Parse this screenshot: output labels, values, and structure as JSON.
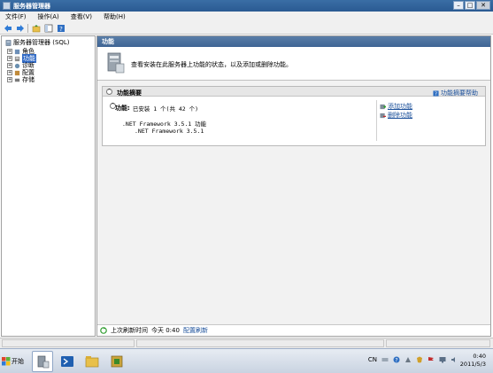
{
  "window": {
    "title": "服务器管理器"
  },
  "menu": [
    "文件(F)",
    "操作(A)",
    "查看(V)",
    "帮助(H)"
  ],
  "tree": {
    "root": "服务器管理器 (SQL)",
    "items": [
      {
        "label": "角色",
        "selected": false
      },
      {
        "label": "功能",
        "selected": true
      },
      {
        "label": "诊断",
        "selected": false
      },
      {
        "label": "配置",
        "selected": false
      },
      {
        "label": "存储",
        "selected": false
      }
    ]
  },
  "content": {
    "header": "功能",
    "description": "查看安装在此服务器上功能的状态，以及添加或删除功能。",
    "summary": {
      "title": "功能摘要",
      "help_link": "功能摘要帮助",
      "features_label": "功能:",
      "features_value": "已安装 1 个(共 42 个)",
      "installed": [
        ".NET Framework 3.5.1 功能",
        ".NET Framework 3.5.1"
      ],
      "actions": [
        "添加功能",
        "删除功能"
      ]
    },
    "refresh": {
      "label": "上次刷新时间",
      "time": "今天 0:40",
      "link": "配置刷新"
    }
  },
  "taskbar": {
    "start": "开始",
    "language": "CN",
    "time": "0:40",
    "date": "2011/5/3"
  }
}
